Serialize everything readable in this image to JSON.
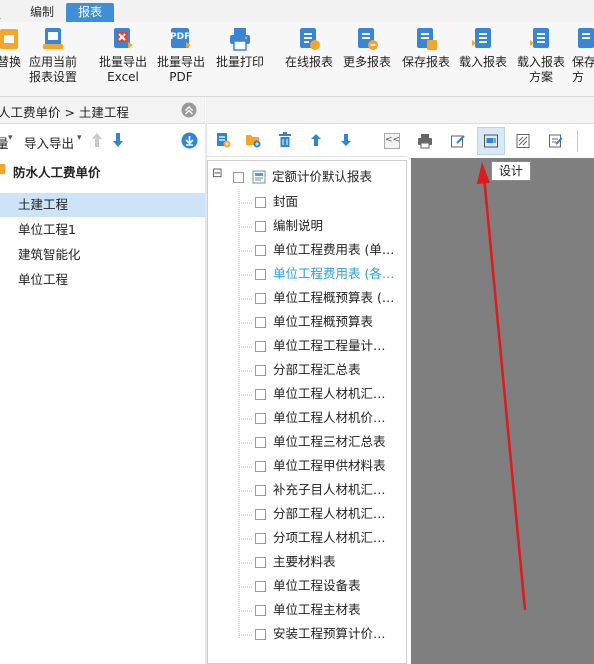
{
  "menu": {
    "tabs": [
      {
        "label": "编制"
      },
      {
        "label": "报表"
      }
    ],
    "left_fragment": "ɀ"
  },
  "ribbon": {
    "buttons": [
      {
        "line1": "替换",
        "line2": "",
        "icon": "replace-icon"
      },
      {
        "line1": "应用当前",
        "line2": "报表设置",
        "icon": "apply-settings-icon"
      },
      {
        "line1": "批量导出",
        "line2": "Excel",
        "icon": "export-excel-icon"
      },
      {
        "line1": "批量导出",
        "line2": "PDF",
        "icon": "export-pdf-icon"
      },
      {
        "line1": "批量打印",
        "line2": "",
        "icon": "batch-print-icon"
      },
      {
        "line1": "在线报表",
        "line2": "",
        "icon": "online-report-icon"
      },
      {
        "line1": "更多报表",
        "line2": "",
        "icon": "more-reports-icon"
      },
      {
        "line1": "保存报表",
        "line2": "",
        "icon": "save-report-icon"
      },
      {
        "line1": "载入报表",
        "line2": "",
        "icon": "load-report-icon"
      },
      {
        "line1": "载入报表",
        "line2": "方案",
        "icon": "load-scheme-icon"
      },
      {
        "line1": "保存",
        "line2": "方",
        "icon": "save-scheme-icon"
      }
    ],
    "pdf_badge": "PDF"
  },
  "breadcrumb": {
    "text": "人工费单价 > 土建工程"
  },
  "left_toolbar": {
    "fragment": "量",
    "import_export": "导入导出"
  },
  "left_tree": {
    "root": "防水人工费单价",
    "items": [
      "土建工程",
      "单位工程1",
      "建筑智能化",
      "单位工程"
    ]
  },
  "report_tree": {
    "root": "定额计价默认报表",
    "items": [
      "封面",
      "编制说明",
      "单位工程费用表 (单…",
      "单位工程费用表 (各…",
      "单位工程概预算表 (…",
      "单位工程概预算表",
      "单位工程工程量计…",
      "分部工程汇总表",
      "单位工程人材机汇…",
      "单位工程人材机价…",
      "单位工程三材汇总表",
      "单位工程甲供材料表",
      "补充子目人材机汇…",
      "分部工程人材机汇…",
      "分项工程人材机汇…",
      "主要材料表",
      "单位工程设备表",
      "单位工程主材表",
      "安装工程预算计价…"
    ],
    "highlight_index": 3,
    "highlight_color": "#2a9fd8",
    "collapse_symbol": "⊟"
  },
  "preview_toolbar": {
    "tooltip": "设计",
    "collapse_symbol": "<<"
  },
  "colors": {
    "accent": "#3f8fd6",
    "preview_bg": "#7f7f7f",
    "arrow": "#e0191b",
    "selection": "#cde4f8"
  }
}
